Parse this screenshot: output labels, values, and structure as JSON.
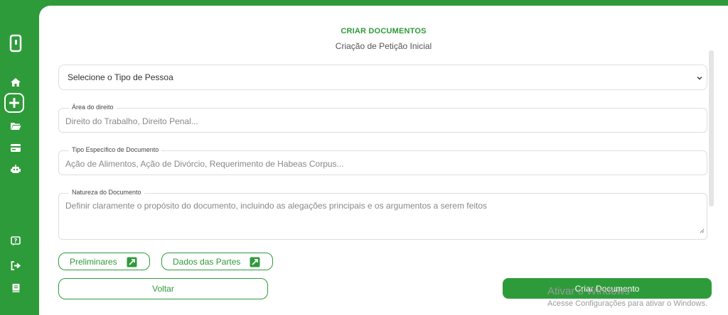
{
  "sidebar": {
    "icons": [
      "logo-icon",
      "home-icon",
      "add-icon",
      "folder-icon",
      "card-icon",
      "robot-icon",
      "help-icon",
      "logout-icon",
      "book-icon"
    ]
  },
  "header": {
    "title": "CRIAR DOCUMENTOS",
    "subtitle": "Criação de Petição Inicial"
  },
  "form": {
    "person_type": {
      "selected": "Selecione o Tipo de Pessoa"
    },
    "area": {
      "label": "Área do direito",
      "placeholder": "Direito do Trabalho, Direito Penal..."
    },
    "doc_type": {
      "label": "Tipo Específico de Documento",
      "placeholder": "Ação de Alimentos, Ação de Divórcio, Requerimento de Habeas Corpus..."
    },
    "nature": {
      "label": "Natureza do Documento",
      "placeholder": "Definir claramente o propósito do documento, incluindo as alegações principais e os argumentos a serem feitos"
    }
  },
  "buttons": {
    "preliminares": "Preliminares",
    "dados_partes": "Dados das Partes",
    "voltar": "Voltar",
    "criar": "Criar Documento"
  },
  "watermark": {
    "line1": "Ativar o Windows",
    "line2": "Acesse Configurações para ativar o Windows."
  },
  "colors": {
    "accent": "#2e9b3a"
  }
}
